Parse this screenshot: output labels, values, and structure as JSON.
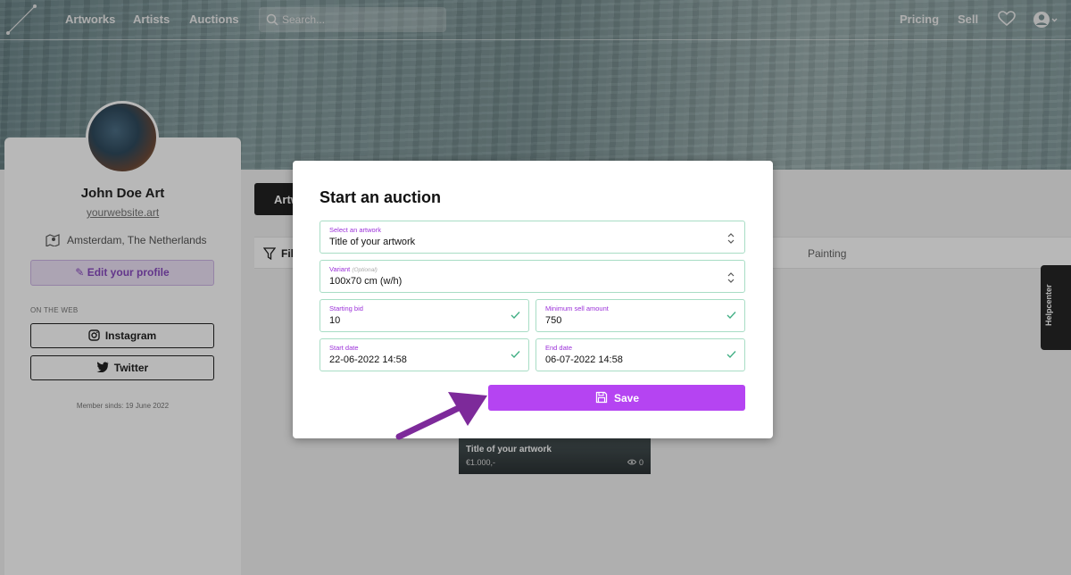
{
  "nav": {
    "links": [
      "Artworks",
      "Artists",
      "Auctions"
    ],
    "search_placeholder": "Search...",
    "right_links": [
      "Pricing",
      "Sell"
    ],
    "icons": [
      "logo-icon",
      "search-icon",
      "heart-icon",
      "account-icon"
    ]
  },
  "profile": {
    "name": "John Doe Art",
    "website": "yourwebsite.art",
    "location": "Amsterdam, The Netherlands",
    "edit_label": "Edit your profile",
    "on_the_web": "ON THE WEB",
    "social": [
      "Instagram",
      "Twitter"
    ],
    "member_since": "Member sinds: 19 June 2022"
  },
  "content": {
    "tab_partial": "Artw",
    "filter_partial": "Fil",
    "category": "Painting",
    "helpcenter": "Helpcenter",
    "artwork_card": {
      "title": "Title of your artwork",
      "price": "€1.000,-",
      "views": "0"
    }
  },
  "modal": {
    "title": "Start an auction",
    "fields": {
      "artwork": {
        "label": "Select an artwork",
        "value": "Title of your artwork"
      },
      "variant": {
        "label": "Variant",
        "optional": "(Optional)",
        "value": "100x70 cm (w/h)"
      },
      "starting_bid": {
        "label": "Starting bid",
        "value": "10"
      },
      "min_sell": {
        "label": "Minimum sell amount",
        "value": "750"
      },
      "start_date": {
        "label": "Start date",
        "value": "22-06-2022 14:58"
      },
      "end_date": {
        "label": "End date",
        "value": "06-07-2022 14:58"
      }
    },
    "save_label": "Save"
  },
  "colors": {
    "accent": "#b544f2",
    "field_border": "#a8ddc5",
    "check": "#3fae83",
    "arrow": "#7d2a9a"
  }
}
